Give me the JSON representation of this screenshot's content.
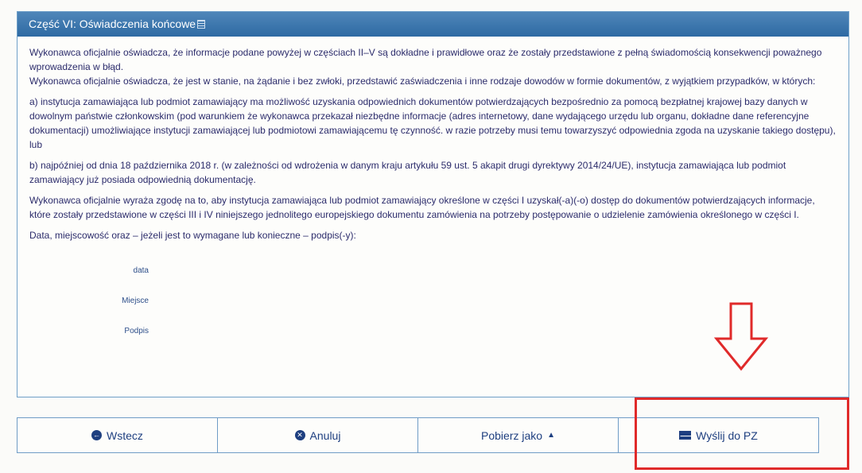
{
  "section": {
    "title": "Część VI: Oświadczenia końcowe",
    "help_icon": "info-icon"
  },
  "body": {
    "line1": "Wykonawca oficjalnie oświadcza, że informacje podane powyżej w częściach II–V są dokładne i prawidłowe oraz że zostały przedstawione z pełną świadomością konsekwencji poważnego wprowadzenia w błąd.",
    "line2": "Wykonawca oficjalnie oświadcza, że jest w stanie, na żądanie i bez zwłoki, przedstawić zaświadczenia i inne rodzaje dowodów w formie dokumentów, z wyjątkiem przypadków, w których:",
    "para_a": "a) instytucja zamawiająca lub podmiot zamawiający ma możliwość uzyskania odpowiednich dokumentów potwierdzających bezpośrednio za pomocą bezpłatnej krajowej bazy danych w dowolnym państwie członkowskim (pod warunkiem że wykonawca przekazał niezbędne informacje (adres internetowy, dane wydającego urzędu lub organu, dokładne dane referencyjne dokumentacji) umożliwiające instytucji zamawiającej lub podmiotowi zamawiającemu tę czynność. w razie potrzeby musi temu towarzyszyć odpowiednia zgoda na uzyskanie takiego dostępu), lub",
    "para_b": "b) najpóźniej od dnia 18 października 2018 r. (w zależności od wdrożenia w danym kraju artykułu 59 ust. 5 akapit drugi dyrektywy 2014/24/UE), instytucja zamawiająca lub podmiot zamawiający już posiada odpowiednią dokumentację.",
    "consent": "Wykonawca oficjalnie wyraża zgodę na to, aby instytucja zamawiająca lub podmiot zamawiający określone w części I uzyskał(-a)(-o) dostęp do dokumentów potwierdzających informacje, które zostały przedstawione w części III i IV niniejszego jednolitego europejskiego dokumentu zamówienia na potrzeby postępowanie o udzielenie zamówienia określonego w części I.",
    "date_place": "Data, miejscowość oraz – jeżeli jest to wymagane lub konieczne – podpis(-y):"
  },
  "fields": {
    "date_label": "data",
    "place_label": "Miejsce",
    "signature_label": "Podpis"
  },
  "buttons": {
    "back": {
      "label": "Wstecz",
      "icon": "arrow-left-circle-icon"
    },
    "cancel": {
      "label": "Anuluj",
      "icon": "close-circle-icon"
    },
    "download": {
      "label": "Pobierz jako",
      "icon": "caret-up-icon"
    },
    "send": {
      "label": "Wyślij do PZ",
      "icon": "envelope-icon"
    }
  },
  "colors": {
    "header": "#2e6aa3",
    "text": "#2b2b6b",
    "annotation": "#e02a2a"
  }
}
